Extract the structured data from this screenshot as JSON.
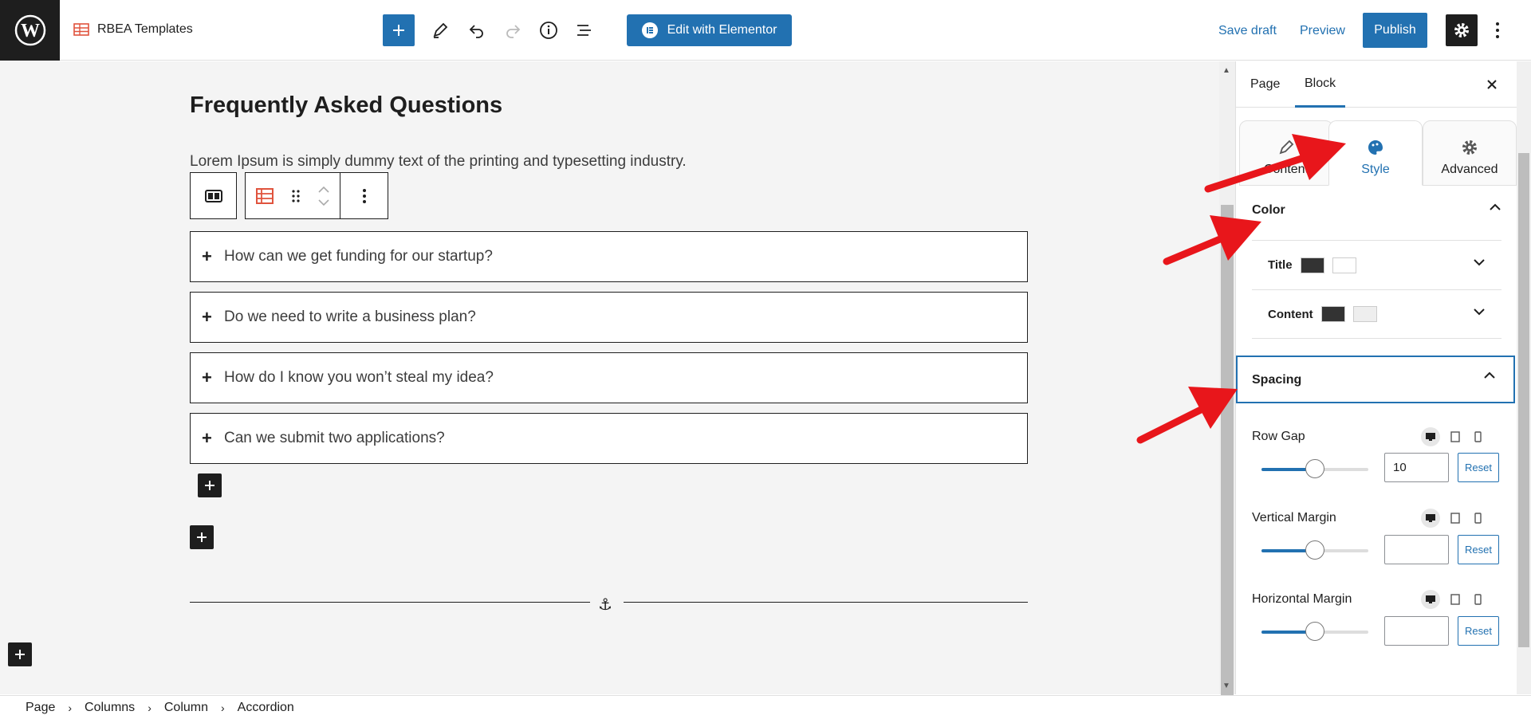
{
  "header": {
    "site_name": "RBEA Templates",
    "elementor_label": "Edit with Elementor",
    "save_draft": "Save draft",
    "preview": "Preview",
    "publish": "Publish"
  },
  "content": {
    "title": "Frequently Asked Questions",
    "description": "Lorem Ipsum is simply dummy text of the printing and typesetting industry.",
    "accordion": [
      "How can we get funding for our startup?",
      "Do we need to write a business plan?",
      "How do I know you won’t steal my idea?",
      "Can we submit two applications?"
    ]
  },
  "sidebar": {
    "tabs": [
      "Page",
      "Block"
    ],
    "subtabs": [
      "Content",
      "Style",
      "Advanced"
    ],
    "color_panel": {
      "title": "Color",
      "rows": [
        {
          "label": "Title",
          "swatches": [
            "#333333",
            "#ffffff"
          ]
        },
        {
          "label": "Content",
          "swatches": [
            "#333333",
            "#eeeeee"
          ]
        }
      ]
    },
    "spacing_panel": {
      "title": "Spacing",
      "controls": [
        {
          "label": "Row Gap",
          "value": "10",
          "reset": "Reset"
        },
        {
          "label": "Vertical Margin",
          "value": "",
          "reset": "Reset"
        },
        {
          "label": "Horizontal Margin",
          "value": "",
          "reset": "Reset"
        }
      ]
    }
  },
  "breadcrumb": [
    "Page",
    "Columns",
    "Column",
    "Accordion"
  ],
  "colors": {
    "accent": "#2271b1",
    "dark": "#1e1e1e",
    "arrow": "#e8161b",
    "block_icon": "#e0533d"
  }
}
